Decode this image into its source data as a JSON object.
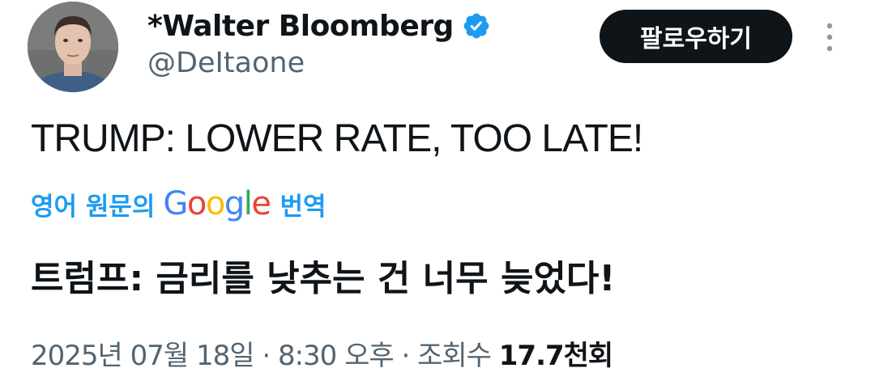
{
  "author": {
    "display_name": "*Walter Bloomberg",
    "handle": "@DeItaone",
    "verified": true
  },
  "follow_button_label": "팔로우하기",
  "tweet": {
    "text": "TRUMP: LOWER RATE, TOO LATE!"
  },
  "translation": {
    "label": "영어 원문의",
    "provider": "Google",
    "action": "번역",
    "text": "트럼프: 금리를 낮추는 건 너무 늦었다!"
  },
  "meta": {
    "date": "2025년 07월 18일",
    "separator": "·",
    "time": "8:30 오후",
    "views_label": "조회수",
    "views_count": "17.7천회"
  },
  "colors": {
    "accent": "#1d9bf0",
    "text_primary": "#0f1419",
    "text_secondary": "#536471",
    "button_bg": "#0f1419"
  },
  "icons": {
    "verified": "verified-badge-icon",
    "more": "more-vertical-icon"
  }
}
